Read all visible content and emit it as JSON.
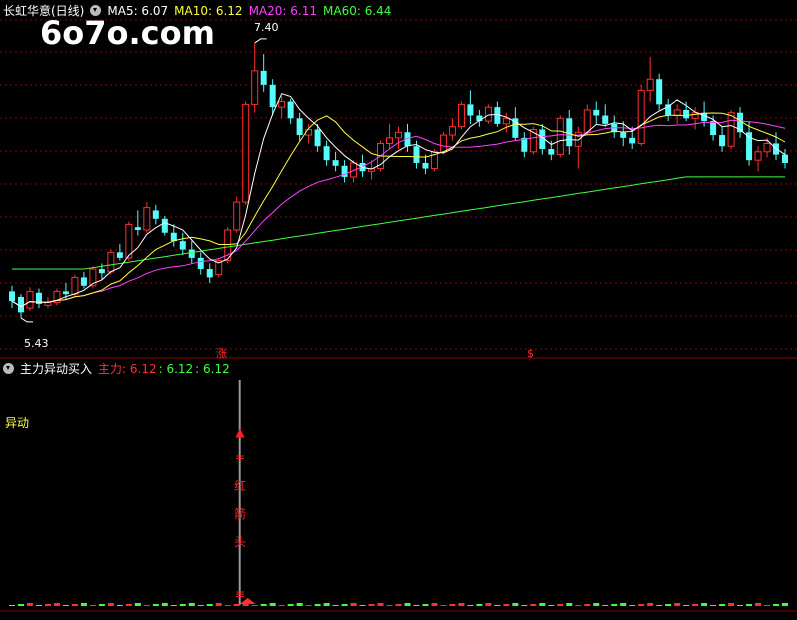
{
  "header": {
    "stock_title": "长虹华意(日线)",
    "ma": [
      {
        "label": "MA5: 6.07",
        "color": "#ffffff"
      },
      {
        "label": "MA10: 6.12",
        "color": "#ffff40"
      },
      {
        "label": "MA20: 6.11",
        "color": "#ff40ff"
      },
      {
        "label": "MA60: 6.44",
        "color": "#40ff40"
      }
    ]
  },
  "watermark": "6o7o.com",
  "price_panel": {
    "high_label": "7.40",
    "low_label": "5.43",
    "marker_zhang": "涨",
    "marker_s": "$"
  },
  "indicator": {
    "title": "主力异动买入",
    "main_label": "主力: 6.12",
    "val2": ": 6.12",
    "val3": ": 6.12",
    "side_label": "异动",
    "arrow_text": [
      "▲",
      "=",
      "红",
      "箭",
      "头"
    ],
    "bottom_marker": "≡"
  },
  "colors": {
    "up": "#ff3030",
    "down": "#54fcfc",
    "ma5": "#ffffff",
    "ma10": "#ffff40",
    "ma20": "#ff40ff",
    "ma60": "#40ff40",
    "grid": "#8b0000"
  },
  "chart_data": {
    "type": "candlestick",
    "title": "长虹华意(日线)",
    "price_range": [
      5.2,
      7.55
    ],
    "labeled_high": 7.4,
    "labeled_low": 5.43,
    "ohlc": [
      [
        5.62,
        5.66,
        5.5,
        5.55
      ],
      [
        5.58,
        5.6,
        5.43,
        5.47
      ],
      [
        5.5,
        5.65,
        5.48,
        5.62
      ],
      [
        5.61,
        5.64,
        5.5,
        5.53
      ],
      [
        5.52,
        5.58,
        5.5,
        5.54
      ],
      [
        5.54,
        5.64,
        5.52,
        5.62
      ],
      [
        5.62,
        5.68,
        5.56,
        5.6
      ],
      [
        5.6,
        5.74,
        5.58,
        5.72
      ],
      [
        5.72,
        5.76,
        5.64,
        5.66
      ],
      [
        5.66,
        5.8,
        5.64,
        5.78
      ],
      [
        5.78,
        5.82,
        5.7,
        5.75
      ],
      [
        5.76,
        5.92,
        5.74,
        5.9
      ],
      [
        5.9,
        5.96,
        5.84,
        5.86
      ],
      [
        5.86,
        6.12,
        5.84,
        6.1
      ],
      [
        6.08,
        6.2,
        6.02,
        6.06
      ],
      [
        6.06,
        6.26,
        6.04,
        6.22
      ],
      [
        6.2,
        6.24,
        6.1,
        6.14
      ],
      [
        6.14,
        6.16,
        6.02,
        6.04
      ],
      [
        6.04,
        6.1,
        5.94,
        5.98
      ],
      [
        5.98,
        6.04,
        5.88,
        5.92
      ],
      [
        5.92,
        5.98,
        5.82,
        5.86
      ],
      [
        5.86,
        5.9,
        5.74,
        5.78
      ],
      [
        5.78,
        5.82,
        5.68,
        5.72
      ],
      [
        5.74,
        5.86,
        5.72,
        5.84
      ],
      [
        5.84,
        6.08,
        5.82,
        6.06
      ],
      [
        6.06,
        6.3,
        6.04,
        6.26
      ],
      [
        6.26,
        6.98,
        6.24,
        6.96
      ],
      [
        6.96,
        7.4,
        6.9,
        7.2
      ],
      [
        7.2,
        7.32,
        7.05,
        7.1
      ],
      [
        7.1,
        7.14,
        6.88,
        6.94
      ],
      [
        6.94,
        7.02,
        6.86,
        6.98
      ],
      [
        6.98,
        7.0,
        6.82,
        6.86
      ],
      [
        6.86,
        6.9,
        6.7,
        6.74
      ],
      [
        6.74,
        6.82,
        6.68,
        6.78
      ],
      [
        6.78,
        6.82,
        6.62,
        6.66
      ],
      [
        6.66,
        6.7,
        6.52,
        6.56
      ],
      [
        6.56,
        6.62,
        6.48,
        6.52
      ],
      [
        6.52,
        6.56,
        6.4,
        6.44
      ],
      [
        6.44,
        6.56,
        6.4,
        6.54
      ],
      [
        6.54,
        6.6,
        6.44,
        6.48
      ],
      [
        6.48,
        6.56,
        6.42,
        6.5
      ],
      [
        6.5,
        6.7,
        6.48,
        6.68
      ],
      [
        6.68,
        6.82,
        6.64,
        6.72
      ],
      [
        6.72,
        6.8,
        6.64,
        6.76
      ],
      [
        6.76,
        6.82,
        6.62,
        6.66
      ],
      [
        6.66,
        6.7,
        6.5,
        6.54
      ],
      [
        6.54,
        6.6,
        6.46,
        6.5
      ],
      [
        6.5,
        6.64,
        6.48,
        6.62
      ],
      [
        6.62,
        6.76,
        6.6,
        6.74
      ],
      [
        6.74,
        6.86,
        6.7,
        6.8
      ],
      [
        6.8,
        6.98,
        6.78,
        6.96
      ],
      [
        6.96,
        7.06,
        6.82,
        6.88
      ],
      [
        6.88,
        6.92,
        6.8,
        6.84
      ],
      [
        6.84,
        6.96,
        6.82,
        6.94
      ],
      [
        6.94,
        6.98,
        6.8,
        6.82
      ],
      [
        6.82,
        6.9,
        6.76,
        6.86
      ],
      [
        6.86,
        6.94,
        6.7,
        6.72
      ],
      [
        6.72,
        6.76,
        6.58,
        6.62
      ],
      [
        6.62,
        6.8,
        6.6,
        6.78
      ],
      [
        6.78,
        6.82,
        6.6,
        6.64
      ],
      [
        6.64,
        6.7,
        6.56,
        6.6
      ],
      [
        6.6,
        6.88,
        6.58,
        6.86
      ],
      [
        6.86,
        6.92,
        6.6,
        6.66
      ],
      [
        6.66,
        6.8,
        6.5,
        6.76
      ],
      [
        6.76,
        6.96,
        6.74,
        6.92
      ],
      [
        6.92,
        6.98,
        6.82,
        6.88
      ],
      [
        6.88,
        6.96,
        6.8,
        6.82
      ],
      [
        6.82,
        6.88,
        6.72,
        6.76
      ],
      [
        6.76,
        6.84,
        6.66,
        6.72
      ],
      [
        6.72,
        6.8,
        6.64,
        6.68
      ],
      [
        6.68,
        7.1,
        6.66,
        7.06
      ],
      [
        7.06,
        7.3,
        6.98,
        7.14
      ],
      [
        7.14,
        7.18,
        6.92,
        6.96
      ],
      [
        6.96,
        7.0,
        6.84,
        6.88
      ],
      [
        6.88,
        6.96,
        6.82,
        6.92
      ],
      [
        6.92,
        6.98,
        6.84,
        6.86
      ],
      [
        6.86,
        6.94,
        6.78,
        6.9
      ],
      [
        6.9,
        6.98,
        6.8,
        6.84
      ],
      [
        6.84,
        6.88,
        6.7,
        6.74
      ],
      [
        6.74,
        6.8,
        6.62,
        6.66
      ],
      [
        6.66,
        6.92,
        6.64,
        6.9
      ],
      [
        6.9,
        6.94,
        6.72,
        6.76
      ],
      [
        6.76,
        6.84,
        6.52,
        6.56
      ],
      [
        6.56,
        6.66,
        6.48,
        6.62
      ],
      [
        6.62,
        6.72,
        6.58,
        6.68
      ],
      [
        6.68,
        6.76,
        6.56,
        6.6
      ],
      [
        6.6,
        6.64,
        6.5,
        6.54
      ]
    ],
    "series": [
      {
        "name": "MA5",
        "last": 6.07
      },
      {
        "name": "MA10",
        "last": 6.12
      },
      {
        "name": "MA20",
        "last": 6.11
      },
      {
        "name": "MA60",
        "last": 6.44
      }
    ],
    "indicator_series": {
      "name": "主力",
      "last": 6.12,
      "signal_bar_index": 26
    }
  }
}
